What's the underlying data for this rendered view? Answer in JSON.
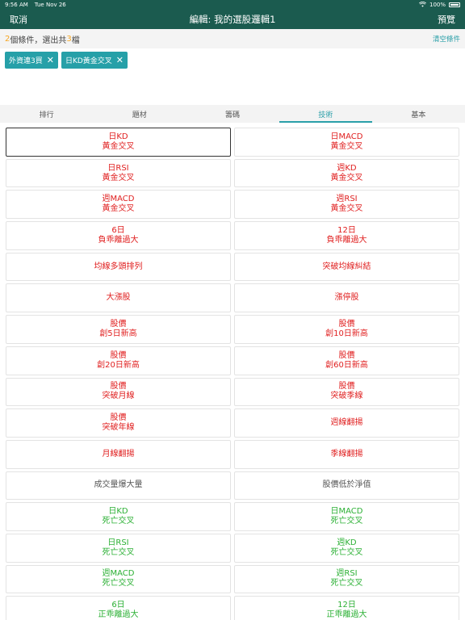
{
  "status_bar": {
    "time": "9:56 AM",
    "date": "Tue Nov 26",
    "battery": "100%"
  },
  "nav": {
    "cancel": "取消",
    "title": "編輯: 我的選股邏輯1",
    "preview": "預覽"
  },
  "summary": {
    "count": "2",
    "text1": "個條件，選出共",
    "found": "3",
    "text2": "檔",
    "clear": "清空條件"
  },
  "chips": [
    "外資連3買",
    "日KD黃金交叉"
  ],
  "tabs": [
    "排行",
    "題材",
    "籌碼",
    "技術",
    "基本"
  ],
  "active_tab": "技術",
  "colors": {
    "nav_bg": "#1b5b4f",
    "accent": "#26a0a8",
    "count": "#f5a623",
    "red": "#e02020",
    "green": "#2bb034"
  },
  "options": [
    {
      "label": "日KD\n黃金交叉",
      "color": "red",
      "selected": true
    },
    {
      "label": "日MACD\n黃金交叉",
      "color": "red"
    },
    {
      "label": "日RSI\n黃金交叉",
      "color": "red"
    },
    {
      "label": "週KD\n黃金交叉",
      "color": "red"
    },
    {
      "label": "週MACD\n黃金交叉",
      "color": "red"
    },
    {
      "label": "週RSI\n黃金交叉",
      "color": "red"
    },
    {
      "label": "6日\n負乖離過大",
      "color": "red"
    },
    {
      "label": "12日\n負乖離過大",
      "color": "red"
    },
    {
      "label": "均線多頭排列",
      "color": "red"
    },
    {
      "label": "突破均線糾結",
      "color": "red"
    },
    {
      "label": "大漲股",
      "color": "red"
    },
    {
      "label": "漲停股",
      "color": "red"
    },
    {
      "label": "股價\n創5日新高",
      "color": "red"
    },
    {
      "label": "股價\n創10日新高",
      "color": "red"
    },
    {
      "label": "股價\n創20日新高",
      "color": "red"
    },
    {
      "label": "股價\n創60日新高",
      "color": "red"
    },
    {
      "label": "股價\n突破月線",
      "color": "red"
    },
    {
      "label": "股價\n突破季線",
      "color": "red"
    },
    {
      "label": "股價\n突破年線",
      "color": "red"
    },
    {
      "label": "週線翻揚",
      "color": "red"
    },
    {
      "label": "月線翻揚",
      "color": "red"
    },
    {
      "label": "季線翻揚",
      "color": "red"
    },
    {
      "label": "成交量爆大量",
      "color": "gray"
    },
    {
      "label": "股價低於淨值",
      "color": "gray"
    },
    {
      "label": "日KD\n死亡交叉",
      "color": "green"
    },
    {
      "label": "日MACD\n死亡交叉",
      "color": "green"
    },
    {
      "label": "日RSI\n死亡交叉",
      "color": "green"
    },
    {
      "label": "週KD\n死亡交叉",
      "color": "green"
    },
    {
      "label": "週MACD\n死亡交叉",
      "color": "green"
    },
    {
      "label": "週RSI\n死亡交叉",
      "color": "green"
    },
    {
      "label": "6日\n正乖離過大",
      "color": "green"
    },
    {
      "label": "12日\n正乖離過大",
      "color": "green"
    }
  ]
}
